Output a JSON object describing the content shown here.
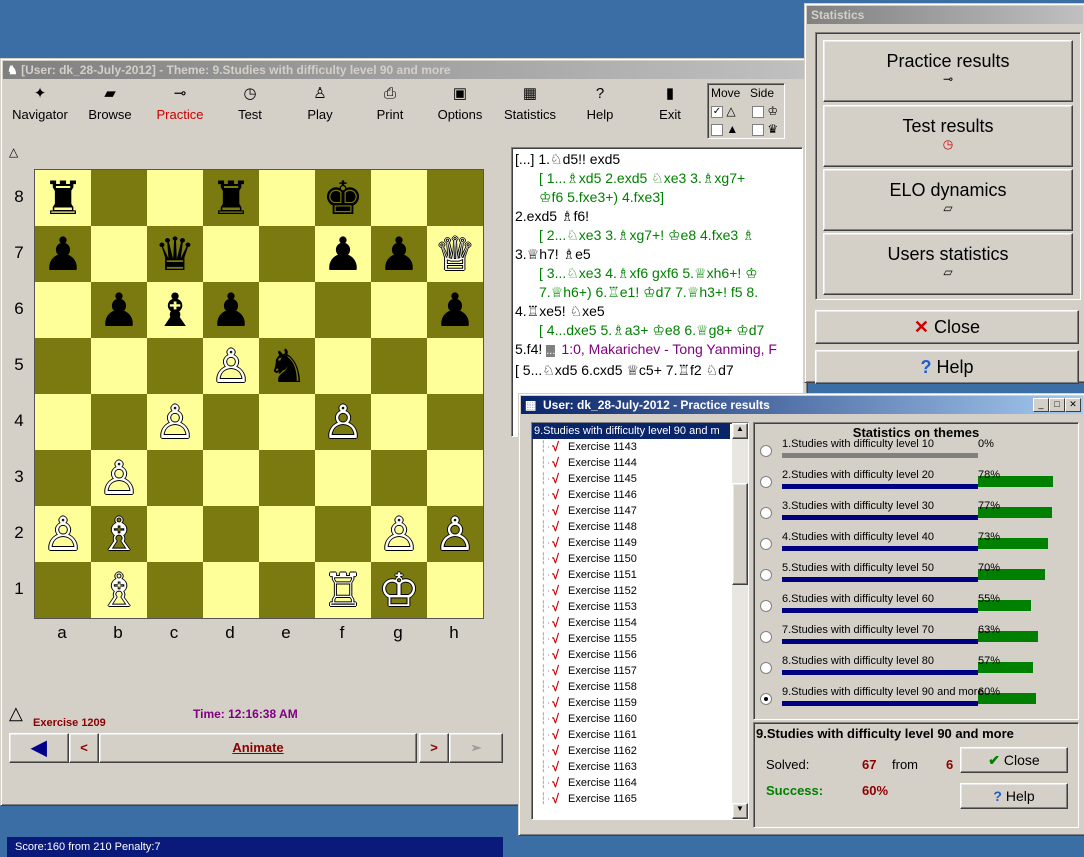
{
  "main": {
    "title": "[User: dk_28-July-2012]  - Theme: 9.Studies with difficulty level 90 and more",
    "toolbar": [
      {
        "label": "Navigator",
        "icon": "navigator-icon"
      },
      {
        "label": "Browse",
        "icon": "browse-icon"
      },
      {
        "label": "Practice",
        "icon": "key-icon",
        "active": true
      },
      {
        "label": "Test",
        "icon": "clock-icon"
      },
      {
        "label": "Play",
        "icon": "pawn-icon"
      },
      {
        "label": "Print",
        "icon": "printer-icon"
      },
      {
        "label": "Options",
        "icon": "monitor-icon"
      },
      {
        "label": "Statistics",
        "icon": "table-icon"
      },
      {
        "label": "Help",
        "icon": "question-icon"
      },
      {
        "label": "Exit",
        "icon": "exit-icon"
      }
    ],
    "move_label": "Move",
    "side_label": "Side",
    "ranks": [
      "8",
      "7",
      "6",
      "5",
      "4",
      "3",
      "2",
      "1"
    ],
    "files": [
      "a",
      "b",
      "c",
      "d",
      "e",
      "f",
      "g",
      "h"
    ],
    "exercise": "Exercise 1209",
    "time": "Time:  12:16:38 AM",
    "animate": "Animate",
    "status": "Score:160 from 210    Penalty:7",
    "notation": [
      "[...] 1.♘d5!! exd5",
      "[ 1...♗xd5  2.exd5  ♘xe3  3.♗xg7+",
      "♔f6 5.fxe3+) 4.fxe3]",
      "2.exd5 ♗f6!",
      "[ 2...♘xe3 3.♗xg7+! ♔e8 4.fxe3 ♗",
      "3.♕h7! ♗e5",
      "[ 3...♘xe3 4.♗xf6 gxf6 5.♕xh6+! ♔",
      "7.♕h6+) 6.♖e1! ♔d7 7.♕h3+! f5 8.",
      "4.♖xe5! ♘xe5",
      "[ 4...dxe5 5.♗a3+ ♔e8 6.♕g8+ ♔d7",
      "5.f4!",
      "1:0, Makarichev - Tong Yanming, F",
      "[ 5...♘xd5 6.cxd5 ♕c5+ 7.♖f2 ♘d7"
    ]
  },
  "stats": {
    "title": "Statistics",
    "practice": "Practice results",
    "test": "Test results",
    "elo": "ELO dynamics",
    "users": "Users statistics",
    "close": "Close",
    "help": "Help"
  },
  "results": {
    "title": "User: dk_28-July-2012 - Practice results",
    "root": "9.Studies with difficulty level 90 and m",
    "exercises": [
      "Exercise 1143",
      "Exercise 1144",
      "Exercise 1145",
      "Exercise 1146",
      "Exercise 1147",
      "Exercise 1148",
      "Exercise 1149",
      "Exercise 1150",
      "Exercise 1151",
      "Exercise 1152",
      "Exercise 1153",
      "Exercise 1154",
      "Exercise 1155",
      "Exercise 1156",
      "Exercise 1157",
      "Exercise 1158",
      "Exercise 1159",
      "Exercise 1160",
      "Exercise 1161",
      "Exercise 1162",
      "Exercise 1163",
      "Exercise 1164",
      "Exercise 1165"
    ],
    "themes_title": "Statistics on themes",
    "themes": [
      {
        "name": "1.Studies with difficulty level 10",
        "pct": "0%",
        "v": 0
      },
      {
        "name": "2.Studies with difficulty level 20",
        "pct": "78%",
        "v": 78
      },
      {
        "name": "3.Studies with difficulty level 30",
        "pct": "77%",
        "v": 77
      },
      {
        "name": "4.Studies with difficulty level 40",
        "pct": "73%",
        "v": 73
      },
      {
        "name": "5.Studies with difficulty level 50",
        "pct": "70%",
        "v": 70
      },
      {
        "name": "6.Studies with difficulty level 60",
        "pct": "55%",
        "v": 55
      },
      {
        "name": "7.Studies with difficulty level 70",
        "pct": "63%",
        "v": 63
      },
      {
        "name": "8.Studies with difficulty level 80",
        "pct": "57%",
        "v": 57
      },
      {
        "name": "9.Studies with difficulty level 90 and more",
        "pct": "60%",
        "v": 60
      }
    ],
    "selected_theme": "9.Studies with difficulty level 90 and more",
    "solved_label": "Solved:",
    "solved": "67",
    "from_label": "from",
    "from_value": "6",
    "success_label": "Success:",
    "success": "60%",
    "close": "Close",
    "help": "Help"
  }
}
